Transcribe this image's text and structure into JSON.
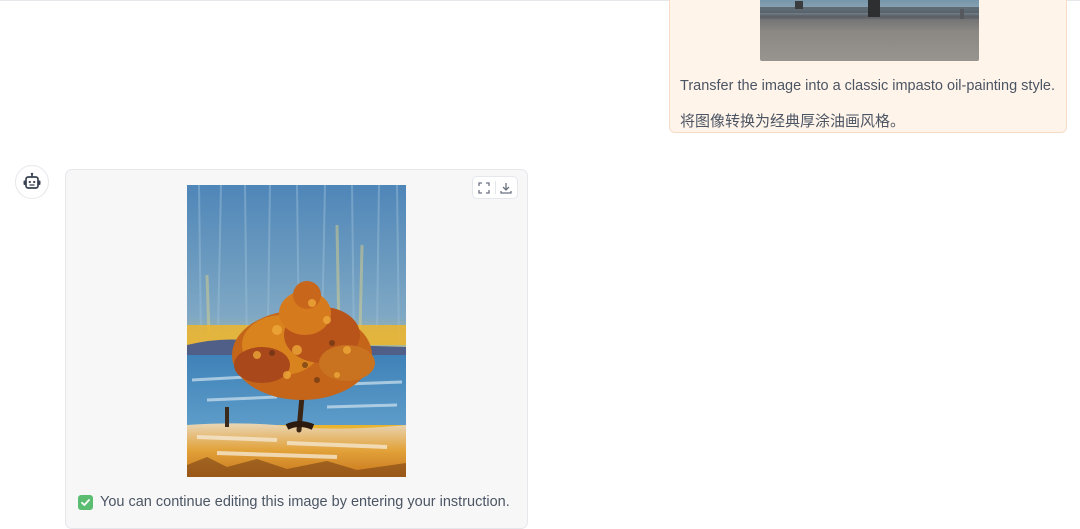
{
  "user_message": {
    "text_en": "Transfer the image into a classic impasto oil-painting style.",
    "text_zh": "将图像转换为经典厚涂油画风格。"
  },
  "bot_message": {
    "status_text": "You can continue editing this image by entering your instruction.",
    "toolbar": {
      "fullscreen_icon": "fullscreen-icon",
      "download_icon": "download-icon"
    }
  },
  "icons": {
    "bot": "robot-icon",
    "status": "check-box-icon"
  },
  "colors": {
    "user_bubble_bg": "#fff4ea",
    "user_bubble_border": "#f6dcc6",
    "bot_card_bg": "#f7f7f8",
    "check_green": "#5bbd72"
  }
}
